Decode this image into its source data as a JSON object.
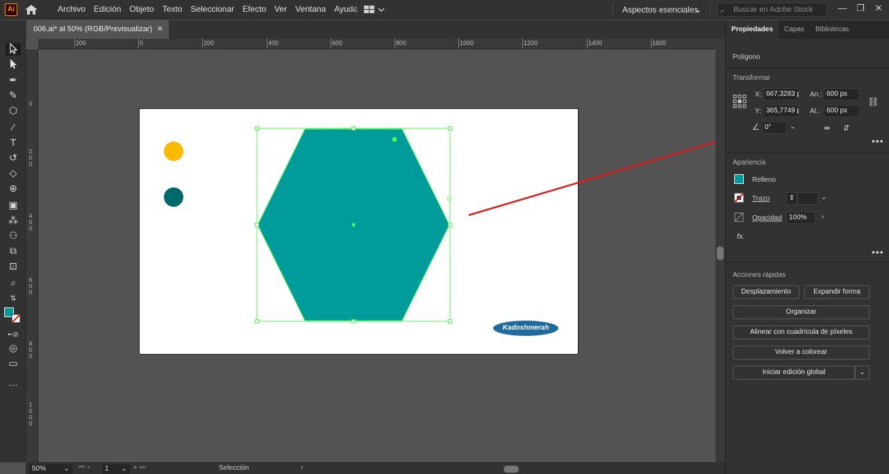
{
  "app": {
    "logo": "Ai"
  },
  "menu": [
    "Archivo",
    "Edición",
    "Objeto",
    "Texto",
    "Seleccionar",
    "Efecto",
    "Ver",
    "Ventana",
    "Ayuda"
  ],
  "workspace": "Aspectos esenciales",
  "search_placeholder": "Buscar en Adobe Stock",
  "document_tab": "006.ai* al 50% (RGB/Previsualizar)",
  "ruler": {
    "h": [
      "200",
      "0",
      "200",
      "400",
      "600",
      "800",
      "1000",
      "1200",
      "1400",
      "1600"
    ],
    "v": [
      "0",
      "2\n0\n0",
      "4\n0\n0",
      "6\n0\n0",
      "8\n0\n0",
      "1\n0\n0\n0"
    ]
  },
  "panel": {
    "tabs": [
      "Propiedades",
      "Capas",
      "Bibliotecas"
    ],
    "object_type": "Polígono",
    "transform": {
      "title": "Transformar",
      "x_label": "X:",
      "x": "667,3283 p",
      "y_label": "Y:",
      "y": "365,7749 p",
      "w_label": "An.:",
      "w": "600 px",
      "h_label": "Al.:",
      "h": "600 px",
      "angle": "0°"
    },
    "appearance": {
      "title": "Apariencia",
      "fill": "Relleno",
      "stroke": "Trazo",
      "opacity_label": "Opacidad",
      "opacity": "100%",
      "fx": "fx."
    },
    "quick_actions": {
      "title": "Acciones rápidas",
      "offset": "Desplazamiento",
      "expand": "Expandir forma",
      "arrange": "Organizar",
      "align_pixel": "Alinear con cuadrícula de píxeles",
      "recolor": "Volver a colorear",
      "global_edit": "Iniciar edición global"
    }
  },
  "artboard": {
    "badge_text": "Kadoshmerah"
  },
  "colors": {
    "fill": "#009b9b",
    "yellow_dot": "#fbb900",
    "teal_dot": "#006a6a",
    "selection": "#4dff4d",
    "annotation": "#e01b1b"
  },
  "status": {
    "zoom": "50%",
    "page": "1",
    "tool": "Selección"
  }
}
